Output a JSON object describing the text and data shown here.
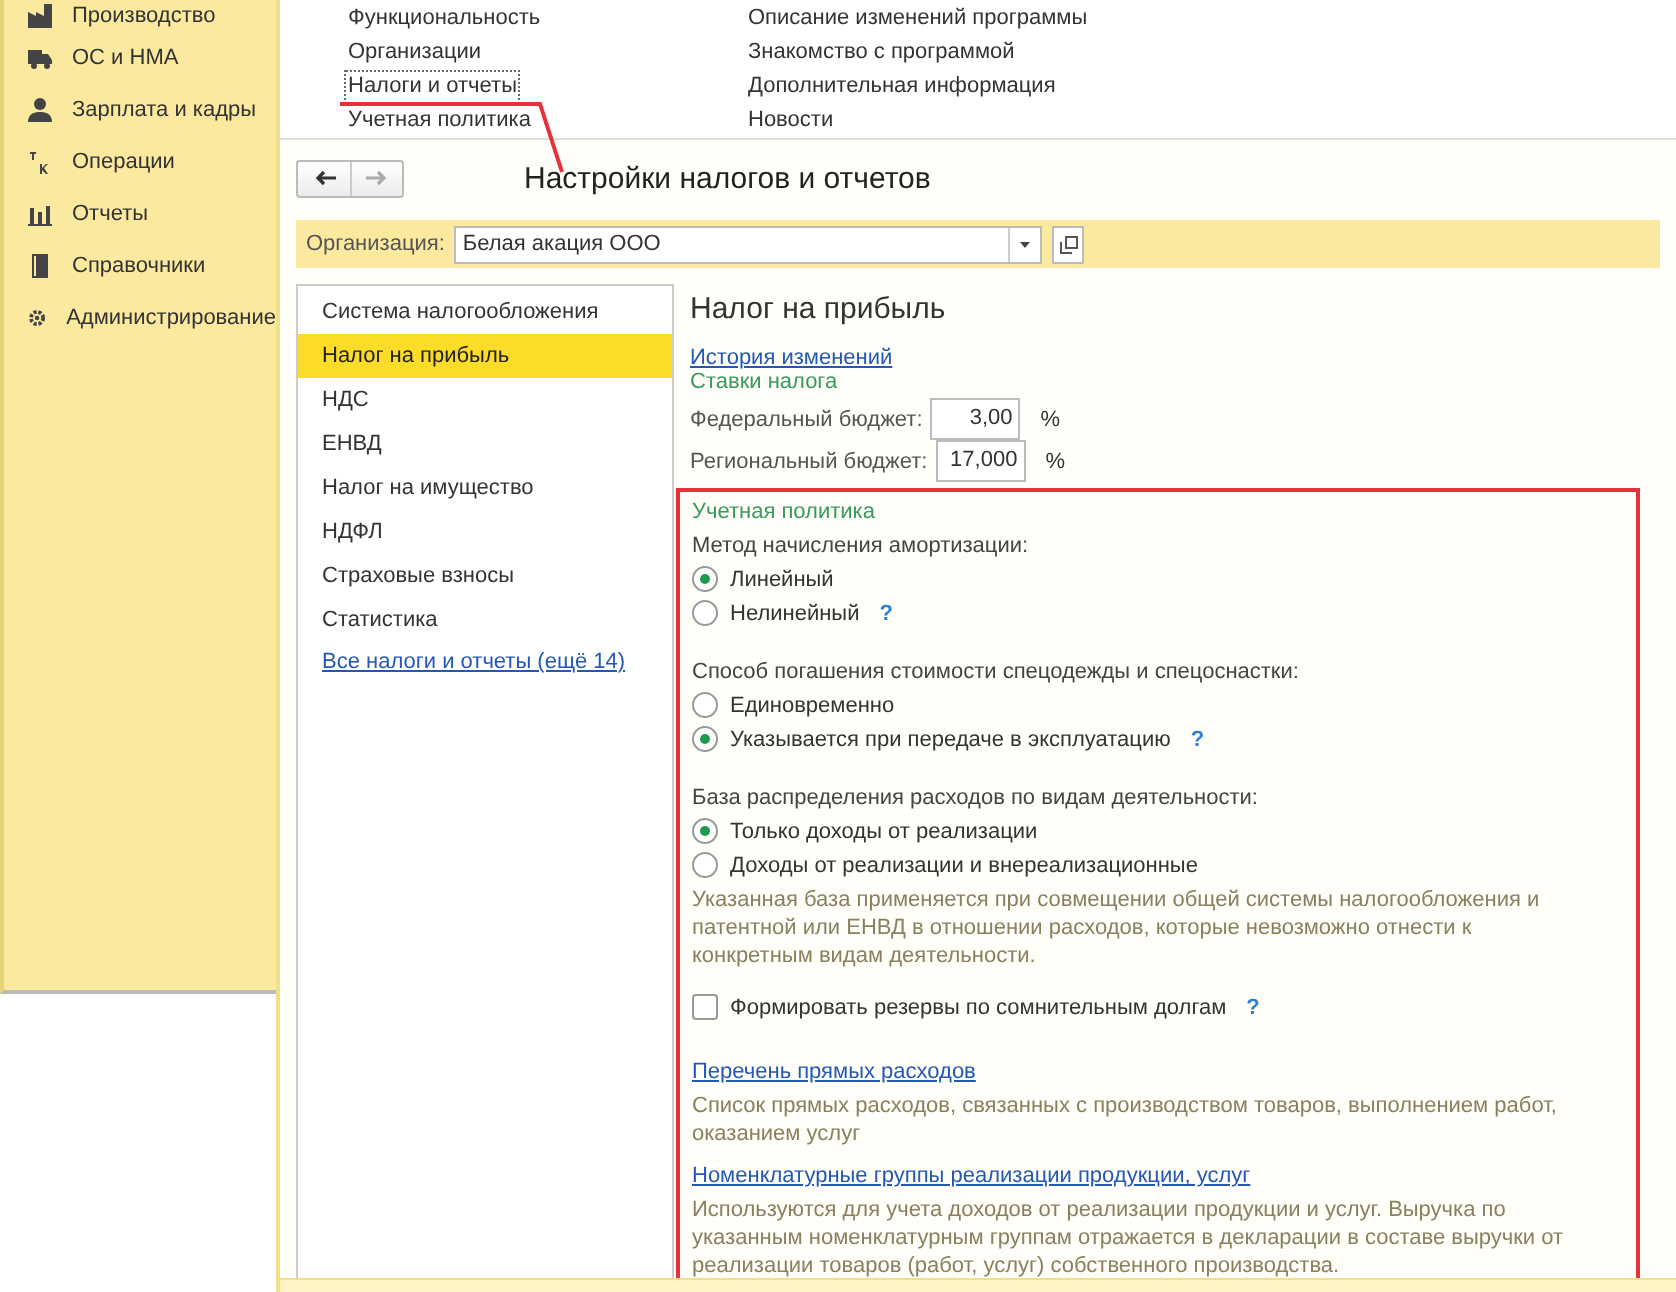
{
  "sidebar": {
    "items": [
      {
        "label": "Производство"
      },
      {
        "label": "ОС и НМА"
      },
      {
        "label": "Зарплата и кадры"
      },
      {
        "label": "Операции"
      },
      {
        "label": "Отчеты"
      },
      {
        "label": "Справочники"
      },
      {
        "label": "Администрирование"
      }
    ]
  },
  "top_menu": {
    "column_1": [
      {
        "label": "Функциональность",
        "selected": false
      },
      {
        "label": "Организации",
        "selected": false
      },
      {
        "label": "Налоги и отчеты",
        "selected": true
      },
      {
        "label": "Учетная политика",
        "selected": false
      }
    ],
    "column_2": [
      {
        "label": "Описание изменений программы"
      },
      {
        "label": "Знакомство с программой"
      },
      {
        "label": "Дополнительная информация"
      },
      {
        "label": "Новости"
      }
    ]
  },
  "form": {
    "title": "Настройки налогов и отчетов",
    "organization": {
      "label": "Организация:",
      "value": "Белая акация ООО"
    },
    "sections": [
      {
        "label": "Система налогообложения",
        "selected": false
      },
      {
        "label": "Налог на прибыль",
        "selected": true
      },
      {
        "label": "НДС",
        "selected": false
      },
      {
        "label": "ЕНВД",
        "selected": false
      },
      {
        "label": "Налог на имущество",
        "selected": false
      },
      {
        "label": "НДФЛ",
        "selected": false
      },
      {
        "label": "Страховые взносы",
        "selected": false
      },
      {
        "label": "Статистика",
        "selected": false
      }
    ],
    "all_link": "Все налоги и отчеты (ещё 14)",
    "detail": {
      "heading": "Налог на прибыль",
      "history_link": "История изменений",
      "rates": {
        "heading": "Ставки налога",
        "fields": [
          {
            "label": "Федеральный бюджет:",
            "value": "3,00",
            "unit": "%"
          },
          {
            "label": "Региональный бюджет:",
            "value": "17,000",
            "unit": "%"
          }
        ]
      },
      "policy": {
        "heading": "Учетная политика",
        "groups": [
          {
            "label": "Метод начисления амортизации:",
            "options": [
              {
                "label": "Линейный",
                "selected": true
              },
              {
                "label": "Нелинейный",
                "selected": false,
                "help": "?"
              }
            ]
          },
          {
            "label": "Способ погашения стоимости спецодежды и спецоснастки:",
            "options": [
              {
                "label": "Единовременно",
                "selected": false
              },
              {
                "label": "Указывается при передаче в эксплуатацию",
                "selected": true,
                "help": "?"
              }
            ]
          },
          {
            "label": "База распределения расходов по видам деятельности:",
            "options": [
              {
                "label": "Только доходы от реализации",
                "selected": true
              },
              {
                "label": "Доходы от реализации и внереализационные",
                "selected": false
              }
            ],
            "note": "Указанная база применяется при совмещении общей системы налогообложения и патентной или ЕНВД в отношении расходов, которые невозможно отнести к конкретным видам деятельности."
          }
        ],
        "checkbox": {
          "label": "Формировать резервы по сомнительным долгам",
          "checked": false,
          "help": "?"
        },
        "links": [
          {
            "label": "Перечень прямых расходов",
            "description": "Список прямых расходов, связанных с производством товаров, выполнением работ, оказанием услуг"
          },
          {
            "label": "Номенклатурные группы реализации продукции, услуг",
            "description": "Используются для учета доходов от реализации продукции и услуг. Выручка по указанным номенклатурным группам отражается в декларации в составе выручки от реализации товаров (работ, услуг) собственного производства."
          }
        ]
      }
    }
  }
}
